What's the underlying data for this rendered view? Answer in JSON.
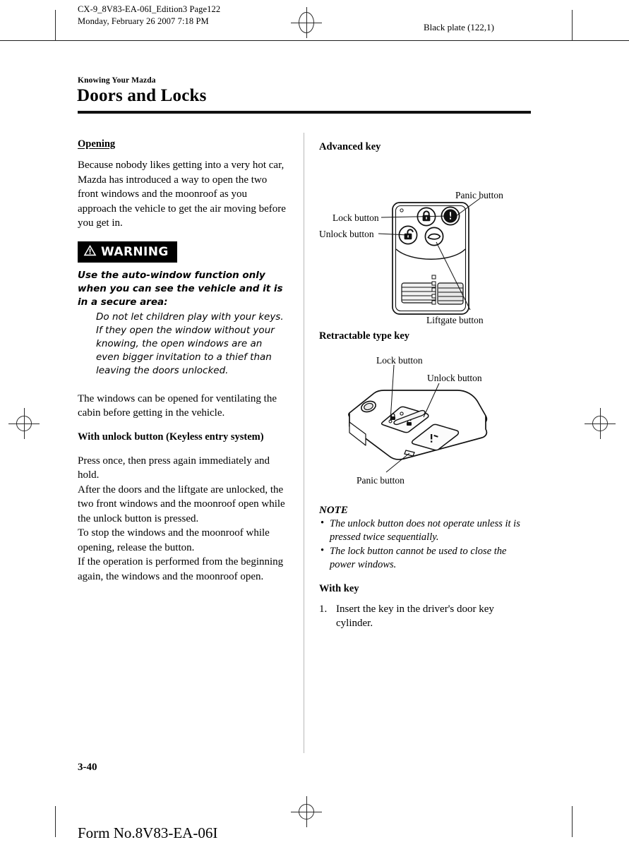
{
  "header": {
    "file_line1": "CX-9_8V83-EA-06I_Edition3 Page122",
    "file_line2": "Monday, February 26 2007 7:18 PM",
    "plate": "Black plate (122,1)"
  },
  "title": {
    "kicker": "Knowing Your Mazda",
    "heading": "Doors and Locks"
  },
  "left_column": {
    "section_heading": "Opening",
    "intro": "Because nobody likes getting into a very hot car, Mazda has introduced a way to open the two front windows and the moonroof as you approach the vehicle to get the air moving before you get in.",
    "warning": {
      "label": "WARNING",
      "lead": "Use the auto-window function only when you can see the vehicle and it is in a secure area:",
      "detail": "Do not let children play with your keys. If they open the window without your knowing, the open windows are an even bigger invitation to a thief than leaving the doors unlocked."
    },
    "after_warning": "The windows can be opened for ventilating the cabin before getting in the vehicle.",
    "subsection_heading": "With unlock button (Keyless entry system)",
    "para1": "Press once, then press again immediately and hold.",
    "para2": "After the doors and the liftgate are unlocked, the two front windows and the moonroof open while the unlock button is pressed.",
    "para3": "To stop the windows and the moonroof while opening, release the button.",
    "para4": "If the operation is performed from the beginning again, the windows and the moonroof open."
  },
  "right_column": {
    "fig1_heading": "Advanced key",
    "fig1_labels": {
      "panic": "Panic button",
      "lock": "Lock button",
      "unlock": "Unlock button",
      "liftgate": "Liftgate button"
    },
    "fig2_heading": "Retractable type key",
    "fig2_labels": {
      "lock": "Lock button",
      "unlock": "Unlock button",
      "panic": "Panic button"
    },
    "note_heading": "NOTE",
    "notes": [
      "The unlock button does not operate unless it is pressed twice sequentially.",
      "The lock button cannot be used to close the power windows."
    ],
    "with_key_heading": "With key",
    "steps": [
      {
        "num": "1.",
        "text": "Insert the key in the driver's door key cylinder."
      }
    ]
  },
  "footer": {
    "page_number": "3-40",
    "form_number": "Form No.8V83-EA-06I"
  },
  "colors": {
    "ink": "#000000",
    "rule": "#1d1d1d",
    "divider": "#b8b8b8",
    "mark": "#2a2a2a"
  }
}
